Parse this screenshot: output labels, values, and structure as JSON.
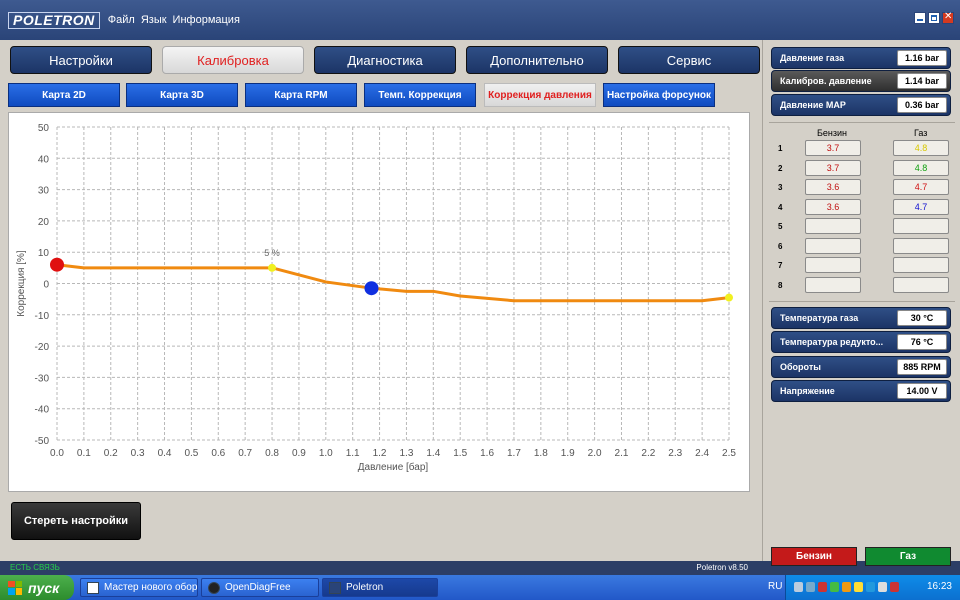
{
  "app": {
    "logo": "POLETRON",
    "menu": [
      "Файл",
      "Язык",
      "Информация"
    ]
  },
  "main_tabs": [
    {
      "label": "Настройки",
      "active": false
    },
    {
      "label": "Калибровка",
      "active": true
    },
    {
      "label": "Диагностика",
      "active": false
    },
    {
      "label": "Дополнительно",
      "active": false
    },
    {
      "label": "Сервис",
      "active": false
    }
  ],
  "sub_tabs": [
    {
      "label": "Карта 2D",
      "active": false
    },
    {
      "label": "Карта 3D",
      "active": false
    },
    {
      "label": "Карта RPM",
      "active": false
    },
    {
      "label": "Темп. Коррекция",
      "active": false
    },
    {
      "label": "Коррекция давления",
      "active": true
    },
    {
      "label": "Настройка форсунок",
      "active": false
    }
  ],
  "chart_data": {
    "type": "line",
    "xlabel": "Давление [бар]",
    "ylabel": "Коррекция [%]",
    "xlim": [
      0.0,
      2.5
    ],
    "ylim": [
      -50,
      50
    ],
    "x_ticks": [
      "0.0",
      "0.1",
      "0.2",
      "0.3",
      "0.4",
      "0.5",
      "0.6",
      "0.7",
      "0.8",
      "0.9",
      "1.0",
      "1.1",
      "1.2",
      "1.3",
      "1.4",
      "1.5",
      "1.6",
      "1.7",
      "1.8",
      "1.9",
      "2.0",
      "2.1",
      "2.2",
      "2.3",
      "2.4",
      "2.5"
    ],
    "y_ticks": [
      "50",
      "40",
      "30",
      "20",
      "10",
      "0",
      "-10",
      "-20",
      "-30",
      "-40",
      "-50"
    ],
    "grid": true,
    "series": [
      {
        "x": [
          0.0,
          0.1,
          0.8,
          1.0,
          1.17,
          1.3,
          1.4,
          1.5,
          1.7,
          2.4,
          2.5
        ],
        "y": [
          6,
          5,
          5,
          0.5,
          -1.5,
          -2.5,
          -2.5,
          -4,
          -5.5,
          -5.5,
          -4.5
        ]
      }
    ],
    "markers": [
      {
        "x": 0.0,
        "y": 6,
        "color": "#e01010",
        "size": "large"
      },
      {
        "x": 0.8,
        "y": 5,
        "color": "#f0f020",
        "size": "small"
      },
      {
        "x": 1.17,
        "y": -1.5,
        "color": "#1030e0",
        "size": "large"
      },
      {
        "x": 2.5,
        "y": -4.5,
        "color": "#f0f020",
        "size": "small"
      }
    ],
    "annotation": {
      "text": "5 %",
      "x": 0.8,
      "y": 5
    },
    "line_color": "#f08a10"
  },
  "erase_button": "Стереть настройки",
  "status": {
    "connection": "ЕСТЬ СВЯЗЬ",
    "version": "Poletron v8.50"
  },
  "readouts_top": [
    {
      "label": "Давление газа",
      "value": "1.16 bar",
      "style": "blue"
    },
    {
      "label": "Калибров. давление",
      "value": "1.14 bar",
      "style": "gray"
    },
    {
      "label": "Давление MAP",
      "value": "0.36 bar",
      "style": "blue"
    }
  ],
  "injectors": {
    "headers": [
      "Бензин",
      "Газ"
    ],
    "rows": [
      {
        "n": "1",
        "petrol": "3.7",
        "gas": "4.8",
        "gas_color": "#d8c800"
      },
      {
        "n": "2",
        "petrol": "3.7",
        "gas": "4.8",
        "gas_color": "#10a010"
      },
      {
        "n": "3",
        "petrol": "3.6",
        "gas": "4.7",
        "gas_color": "#d01010"
      },
      {
        "n": "4",
        "petrol": "3.6",
        "gas": "4.7",
        "gas_color": "#1010d0"
      },
      {
        "n": "5",
        "petrol": "",
        "gas": "",
        "gas_color": "#000000"
      },
      {
        "n": "6",
        "petrol": "",
        "gas": "",
        "gas_color": "#000000"
      },
      {
        "n": "7",
        "petrol": "",
        "gas": "",
        "gas_color": "#000000"
      },
      {
        "n": "8",
        "petrol": "",
        "gas": "",
        "gas_color": "#000000"
      }
    ],
    "petrol_color": "#c01010"
  },
  "readouts_bottom": [
    {
      "label": "Температура газа",
      "value": "30 °C"
    },
    {
      "label": "Температура редукто...",
      "value": "76 °C"
    },
    {
      "label": "Обороты",
      "value": "885 RPM"
    },
    {
      "label": "Напряжение",
      "value": "14.00 V"
    }
  ],
  "fuel_buttons": {
    "petrol": "Бензин",
    "gas": "Газ",
    "petrol_color": "#c41a1a",
    "gas_color": "#108a30"
  },
  "taskbar": {
    "start": "пуск",
    "tasks": [
      {
        "label": "Мастер нового обор...",
        "active": false
      },
      {
        "label": "OpenDiagFree",
        "active": false
      },
      {
        "label": "Poletron",
        "active": true
      }
    ],
    "lang": "RU",
    "clock": "16:23"
  }
}
